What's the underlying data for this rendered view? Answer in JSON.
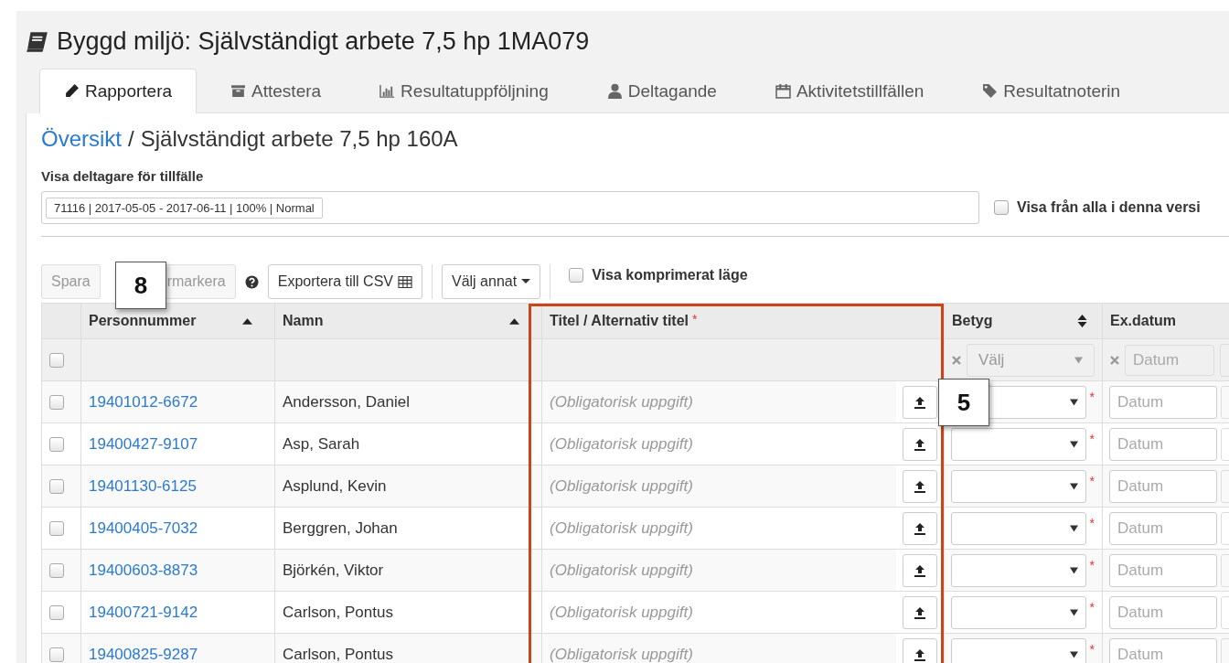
{
  "page_title": "Byggd miljö: Självständigt arbete 7,5 hp 1MA079",
  "tabs": [
    {
      "label": "Rapportera",
      "selected": true
    },
    {
      "label": "Attestera",
      "selected": false
    },
    {
      "label": "Resultatuppföljning",
      "selected": false
    },
    {
      "label": "Deltagande",
      "selected": false
    },
    {
      "label": "Aktivitetstillfällen",
      "selected": false
    },
    {
      "label": "Resultatnoterin",
      "selected": false
    }
  ],
  "breadcrumb": {
    "link": "Översikt",
    "separator": "/",
    "current": "Självständigt arbete 7,5 hp 160A"
  },
  "occasion": {
    "label": "Visa deltagare för tillfälle",
    "tag": "71116 | 2017-05-05 - 2017-06-11 | 100% | Normal"
  },
  "show_all": {
    "label": "Visa från alla i denna versi",
    "checked": false
  },
  "toolbar": {
    "save": {
      "label": "Spara",
      "disabled": true
    },
    "deselect": {
      "label": "rmarkera",
      "disabled": true
    },
    "export": "Exportera till CSV",
    "choose": "Välj annat",
    "compressed": {
      "label": "Visa komprimerat läge",
      "checked": false
    }
  },
  "table": {
    "columns": [
      {
        "label": "Personnummer",
        "sorted": true
      },
      {
        "label": "Namn",
        "sorted": true
      },
      {
        "label": "Titel / Alternativ titel",
        "required_marker": "*"
      },
      {
        "label": "Betyg",
        "sorted": false
      },
      {
        "label": "Ex.datum"
      }
    ],
    "filter": {
      "select_all": false,
      "grade_placeholder": "Välj",
      "date_placeholder": "Datum"
    },
    "rows": [
      {
        "id": "19401012-6672",
        "name": "Andersson, Daniel",
        "checked": false,
        "title_placeholder": "(Obligatorisk uppgift)",
        "grade_required_marker": "*",
        "date_placeholder": "Datum"
      },
      {
        "id": "19400427-9107",
        "name": "Asp, Sarah",
        "checked": false,
        "title_placeholder": "(Obligatorisk uppgift)",
        "grade_required_marker": "*",
        "date_placeholder": "Datum"
      },
      {
        "id": "19401130-6125",
        "name": "Asplund, Kevin",
        "checked": false,
        "title_placeholder": "(Obligatorisk uppgift)",
        "grade_required_marker": "*",
        "date_placeholder": "Datum"
      },
      {
        "id": "19400405-7032",
        "name": "Berggren, Johan",
        "checked": false,
        "title_placeholder": "(Obligatorisk uppgift)",
        "grade_required_marker": "*",
        "date_placeholder": "Datum"
      },
      {
        "id": "19400603-8873",
        "name": "Björkén, Viktor",
        "checked": false,
        "title_placeholder": "(Obligatorisk uppgift)",
        "grade_required_marker": "*",
        "date_placeholder": "Datum"
      },
      {
        "id": "19400721-9142",
        "name": "Carlson, Pontus",
        "checked": false,
        "title_placeholder": "(Obligatorisk uppgift)",
        "grade_required_marker": "*",
        "date_placeholder": "Datum"
      },
      {
        "id": "19400825-9287",
        "name": "Carlson, Pontus",
        "checked": false,
        "title_placeholder": "(Obligatorisk uppgift)",
        "grade_required_marker": "*",
        "date_placeholder": "Datum"
      }
    ]
  },
  "callouts": [
    {
      "label": "8"
    },
    {
      "label": "5"
    }
  ]
}
